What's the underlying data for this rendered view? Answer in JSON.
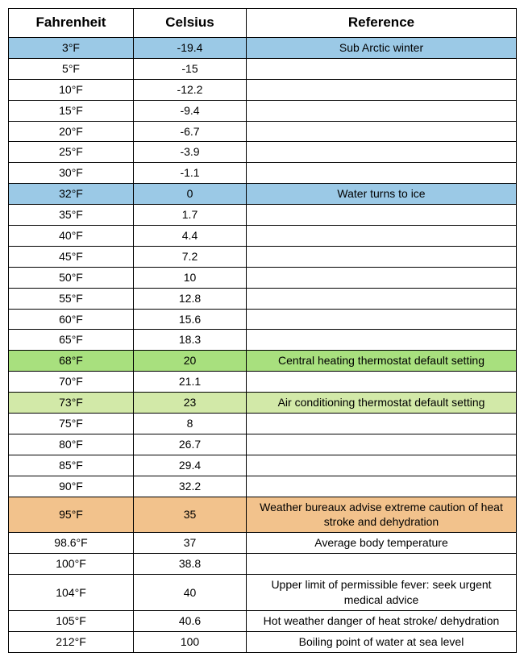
{
  "chart_data": {
    "type": "table",
    "headers": {
      "fahrenheit": "Fahrenheit",
      "celsius": "Celsius",
      "reference": "Reference"
    },
    "rows": [
      {
        "fahrenheit": "3°F",
        "celsius": "-19.4",
        "reference": "Sub Arctic winter",
        "highlight": "blue"
      },
      {
        "fahrenheit": "5°F",
        "celsius": "-15",
        "reference": "",
        "highlight": ""
      },
      {
        "fahrenheit": "10°F",
        "celsius": "-12.2",
        "reference": "",
        "highlight": ""
      },
      {
        "fahrenheit": "15°F",
        "celsius": "-9.4",
        "reference": "",
        "highlight": ""
      },
      {
        "fahrenheit": "20°F",
        "celsius": "-6.7",
        "reference": "",
        "highlight": ""
      },
      {
        "fahrenheit": "25°F",
        "celsius": "-3.9",
        "reference": "",
        "highlight": ""
      },
      {
        "fahrenheit": "30°F",
        "celsius": "-1.1",
        "reference": "",
        "highlight": ""
      },
      {
        "fahrenheit": "32°F",
        "celsius": "0",
        "reference": "Water turns to ice",
        "highlight": "blue"
      },
      {
        "fahrenheit": "35°F",
        "celsius": "1.7",
        "reference": "",
        "highlight": ""
      },
      {
        "fahrenheit": "40°F",
        "celsius": "4.4",
        "reference": "",
        "highlight": ""
      },
      {
        "fahrenheit": "45°F",
        "celsius": "7.2",
        "reference": "",
        "highlight": ""
      },
      {
        "fahrenheit": "50°F",
        "celsius": "10",
        "reference": "",
        "highlight": ""
      },
      {
        "fahrenheit": "55°F",
        "celsius": "12.8",
        "reference": "",
        "highlight": ""
      },
      {
        "fahrenheit": "60°F",
        "celsius": "15.6",
        "reference": "",
        "highlight": ""
      },
      {
        "fahrenheit": "65°F",
        "celsius": "18.3",
        "reference": "",
        "highlight": ""
      },
      {
        "fahrenheit": "68°F",
        "celsius": "20",
        "reference": "Central heating thermostat default setting",
        "highlight": "green"
      },
      {
        "fahrenheit": "70°F",
        "celsius": "21.1",
        "reference": "",
        "highlight": ""
      },
      {
        "fahrenheit": "73°F",
        "celsius": "23",
        "reference": "Air conditioning thermostat default setting",
        "highlight": "lightgreen"
      },
      {
        "fahrenheit": "75°F",
        "celsius": "8",
        "reference": "",
        "highlight": ""
      },
      {
        "fahrenheit": "80°F",
        "celsius": "26.7",
        "reference": "",
        "highlight": ""
      },
      {
        "fahrenheit": "85°F",
        "celsius": "29.4",
        "reference": "",
        "highlight": ""
      },
      {
        "fahrenheit": "90°F",
        "celsius": "32.2",
        "reference": "",
        "highlight": ""
      },
      {
        "fahrenheit": "95°F",
        "celsius": "35",
        "reference": "Weather bureaux advise extreme caution of heat stroke and dehydration",
        "highlight": "orange"
      },
      {
        "fahrenheit": "98.6°F",
        "celsius": "37",
        "reference": "Average body temperature",
        "highlight": ""
      },
      {
        "fahrenheit": "100°F",
        "celsius": "38.8",
        "reference": "",
        "highlight": ""
      },
      {
        "fahrenheit": "104°F",
        "celsius": "40",
        "reference": "Upper limit of permissible fever: seek urgent medical advice",
        "highlight": ""
      },
      {
        "fahrenheit": "105°F",
        "celsius": "40.6",
        "reference": "Hot weather danger of heat stroke/ dehydration",
        "highlight": ""
      },
      {
        "fahrenheit": "212°F",
        "celsius": "100",
        "reference": "Boiling point of water at sea level",
        "highlight": ""
      }
    ]
  }
}
